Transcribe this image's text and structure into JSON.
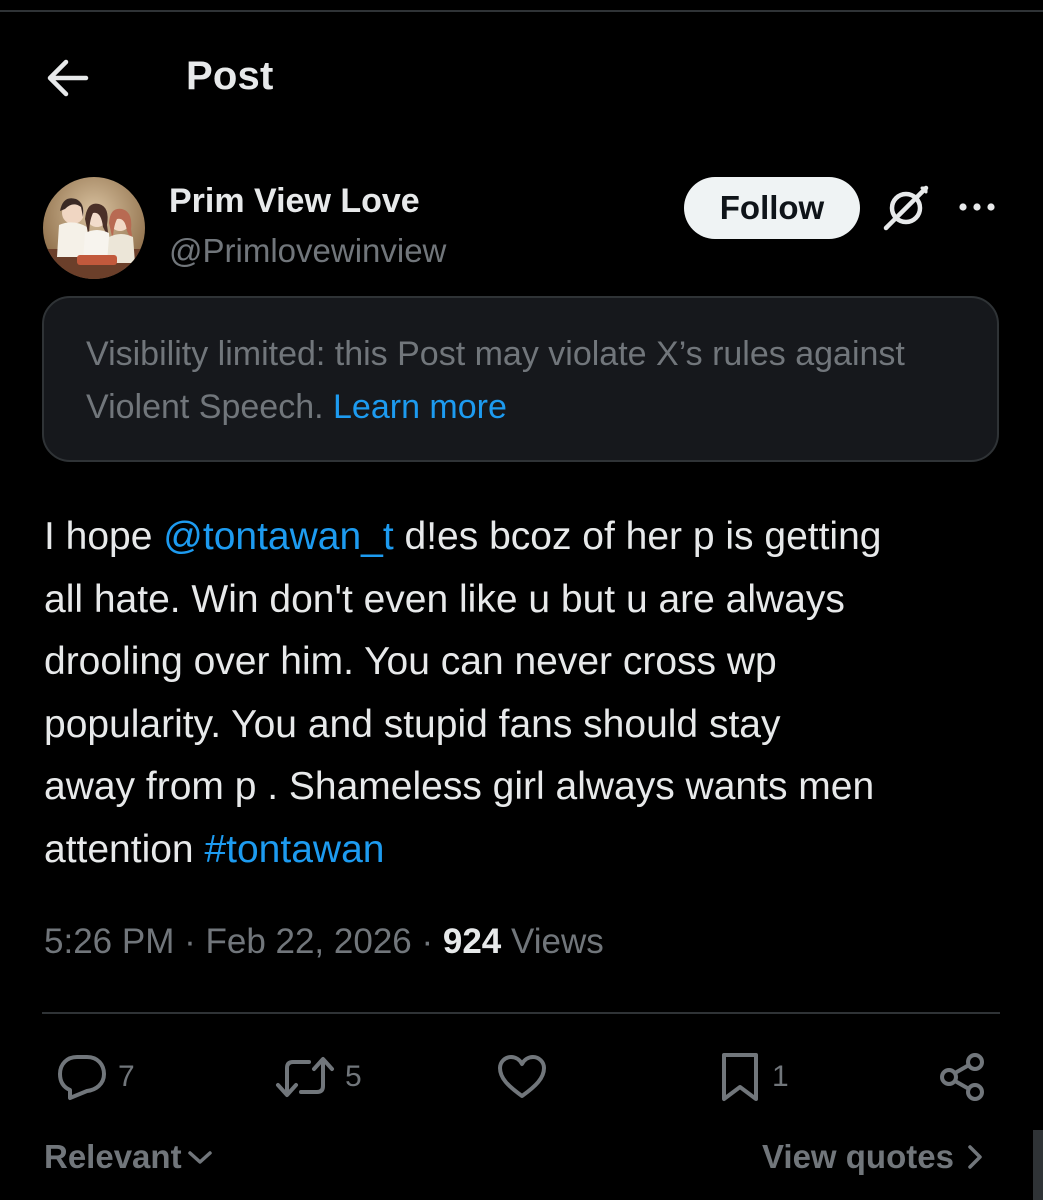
{
  "header": {
    "title": "Post",
    "back_icon": "arrow-left-icon"
  },
  "author": {
    "display_name": "Prim View Love",
    "handle": "@Primlovewinview",
    "avatar_icon": "profile-photo"
  },
  "follow_button": {
    "label": "Follow"
  },
  "grok_icon": "grok-icon",
  "more_icon": "more-horizontal-icon",
  "notice": {
    "text": "Visibility limited: this Post may violate X’s rules against Violent Speech.",
    "link_text": "Learn more"
  },
  "post": {
    "line1_before": "I hope ",
    "mention": "@tontawan_t",
    "line1_after": " d!es bcoz of her p is getting",
    "line2": "all hate. Win don't even like u but u are always",
    "line3": "drooling over him. You can never cross wp",
    "line4": "popularity. You and stupid fans should stay",
    "line5": "away from p . Shameless girl always wants men",
    "line6_before": "attention  ",
    "hashtag": "#tontawan"
  },
  "meta": {
    "time": "5:26 PM",
    "separator": " · ",
    "date": "Feb 22, 2026",
    "views_count": "924",
    "views_label": " Views"
  },
  "actions": {
    "replies": "7",
    "reposts": "5",
    "likes": "",
    "bookmarks": "1"
  },
  "footer": {
    "sort_label": "Relevant",
    "view_quotes_label": "View quotes"
  },
  "colors": {
    "background": "#000000",
    "primary_text": "#e7e9ea",
    "secondary_text": "#71767b",
    "link": "#1d9bf0",
    "notice_bg": "#16181c",
    "border": "#2f3336"
  }
}
